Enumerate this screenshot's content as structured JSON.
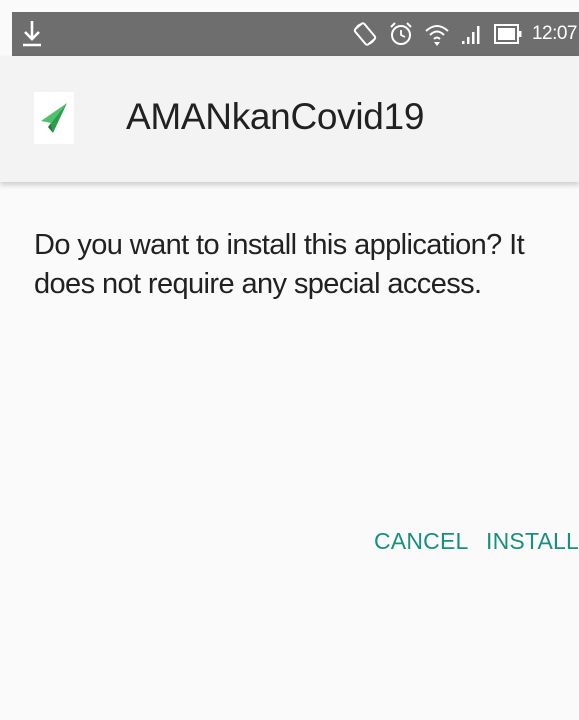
{
  "status_bar": {
    "time": "12:07",
    "background_color": "#6e6e6e",
    "icons": [
      "download-icon",
      "rotate-icon",
      "alarm-icon",
      "wifi-icon",
      "signal-icon",
      "battery-icon"
    ]
  },
  "header": {
    "app_name": "AMANkanCovid19",
    "app_icon": "paper-plane-icon",
    "icon_color": "#4cc26b"
  },
  "dialog": {
    "message": "Do you want to install this application? It does not require any special access."
  },
  "actions": {
    "cancel_label": "CANCEL",
    "install_label": "INSTALL",
    "accent_color": "#198f7f"
  }
}
